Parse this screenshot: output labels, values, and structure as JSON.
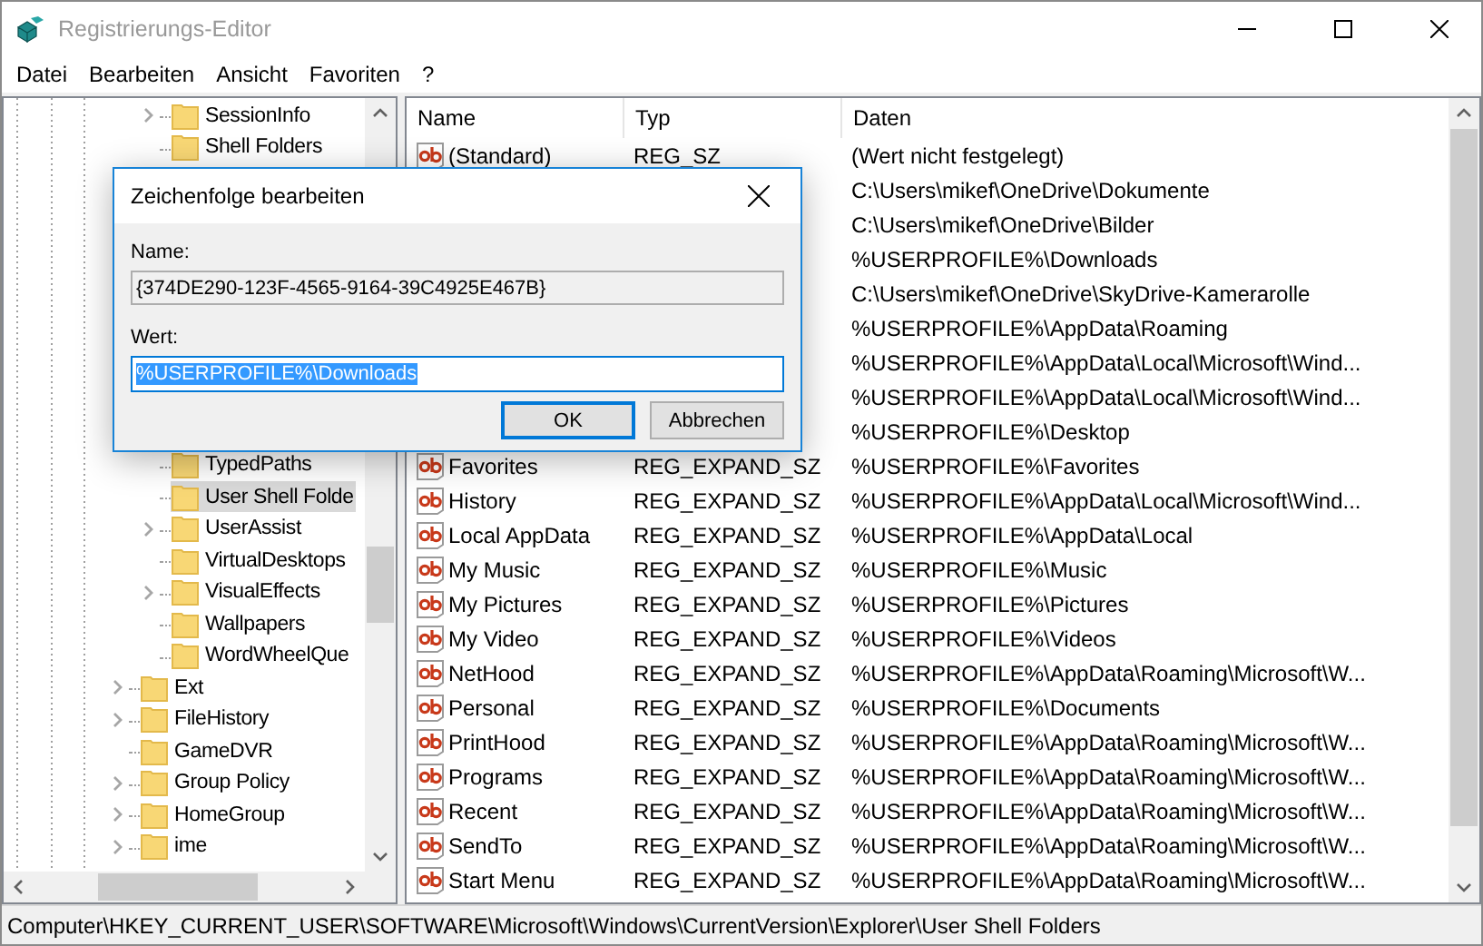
{
  "window": {
    "title": "Registrierungs-Editor"
  },
  "menu": [
    "Datei",
    "Bearbeiten",
    "Ansicht",
    "Favoriten",
    "?"
  ],
  "tree": {
    "items": [
      {
        "children": [
          {
            "label": "SessionInfo",
            "expandable": true,
            "selected": false
          },
          {
            "label": "Shell Folders",
            "expandable": false,
            "selected": false
          },
          {
            "label": "TypedPaths",
            "expandable": false,
            "selected": false
          },
          {
            "label": "User Shell Folde",
            "expandable": false,
            "selected": true
          },
          {
            "label": "UserAssist",
            "expandable": true,
            "selected": false
          },
          {
            "label": "VirtualDesktops",
            "expandable": false,
            "selected": false
          },
          {
            "label": "VisualEffects",
            "expandable": true,
            "selected": false
          },
          {
            "label": "Wallpapers",
            "expandable": false,
            "selected": false
          },
          {
            "label": "WordWheelQue",
            "expandable": false,
            "selected": false
          }
        ]
      },
      {
        "label": "Ext",
        "expandable": true,
        "selected": false
      },
      {
        "label": "FileHistory",
        "expandable": true,
        "selected": false
      },
      {
        "label": "GameDVR",
        "expandable": false,
        "selected": false
      },
      {
        "label": "Group Policy",
        "expandable": true,
        "selected": false
      },
      {
        "label": "HomeGroup",
        "expandable": true,
        "selected": false
      },
      {
        "label": "ime",
        "expandable": true,
        "selected": false
      }
    ]
  },
  "table": {
    "columns": [
      "Name",
      "Typ",
      "Daten"
    ],
    "rows": [
      {
        "name": "(Standard)",
        "type": "REG_SZ",
        "data": "(Wert nicht festgelegt)"
      },
      {
        "data": "C:\\Users\\mikef\\OneDrive\\Dokumente"
      },
      {
        "data": "C:\\Users\\mikef\\OneDrive\\Bilder"
      },
      {
        "data": "%USERPROFILE%\\Downloads"
      },
      {
        "data": "C:\\Users\\mikef\\OneDrive\\SkyDrive-Kamerarolle"
      },
      {
        "data": "%USERPROFILE%\\AppData\\Roaming"
      },
      {
        "data": "%USERPROFILE%\\AppData\\Local\\Microsoft\\Wind..."
      },
      {
        "data": "%USERPROFILE%\\AppData\\Local\\Microsoft\\Wind..."
      },
      {
        "data": "%USERPROFILE%\\Desktop"
      },
      {
        "name": "Favorites",
        "type": "REG_EXPAND_SZ",
        "data": "%USERPROFILE%\\Favorites"
      },
      {
        "name": "History",
        "type": "REG_EXPAND_SZ",
        "data": "%USERPROFILE%\\AppData\\Local\\Microsoft\\Wind..."
      },
      {
        "name": "Local AppData",
        "type": "REG_EXPAND_SZ",
        "data": "%USERPROFILE%\\AppData\\Local"
      },
      {
        "name": "My Music",
        "type": "REG_EXPAND_SZ",
        "data": "%USERPROFILE%\\Music"
      },
      {
        "name": "My Pictures",
        "type": "REG_EXPAND_SZ",
        "data": "%USERPROFILE%\\Pictures"
      },
      {
        "name": "My Video",
        "type": "REG_EXPAND_SZ",
        "data": "%USERPROFILE%\\Videos"
      },
      {
        "name": "NetHood",
        "type": "REG_EXPAND_SZ",
        "data": "%USERPROFILE%\\AppData\\Roaming\\Microsoft\\W..."
      },
      {
        "name": "Personal",
        "type": "REG_EXPAND_SZ",
        "data": "%USERPROFILE%\\Documents"
      },
      {
        "name": "PrintHood",
        "type": "REG_EXPAND_SZ",
        "data": "%USERPROFILE%\\AppData\\Roaming\\Microsoft\\W..."
      },
      {
        "name": "Programs",
        "type": "REG_EXPAND_SZ",
        "data": "%USERPROFILE%\\AppData\\Roaming\\Microsoft\\W..."
      },
      {
        "name": "Recent",
        "type": "REG_EXPAND_SZ",
        "data": "%USERPROFILE%\\AppData\\Roaming\\Microsoft\\W..."
      },
      {
        "name": "SendTo",
        "type": "REG_EXPAND_SZ",
        "data": "%USERPROFILE%\\AppData\\Roaming\\Microsoft\\W..."
      },
      {
        "name": "Start Menu",
        "type": "REG_EXPAND_SZ",
        "data": "%USERPROFILE%\\AppData\\Roaming\\Microsoft\\W..."
      }
    ]
  },
  "status_bar": "Computer\\HKEY_CURRENT_USER\\SOFTWARE\\Microsoft\\Windows\\CurrentVersion\\Explorer\\User Shell Folders",
  "dialog": {
    "title": "Zeichenfolge bearbeiten",
    "name_field": {
      "label": "Name:",
      "value": "{374DE290-123F-4565-9164-39C4925E467B}"
    },
    "value_field": {
      "label": "Wert:",
      "value": "%USERPROFILE%\\Downloads",
      "text_selected": true
    },
    "buttons": [
      {
        "label": "OK",
        "default": true
      },
      {
        "label": "Abbrechen",
        "default": false
      }
    ]
  }
}
